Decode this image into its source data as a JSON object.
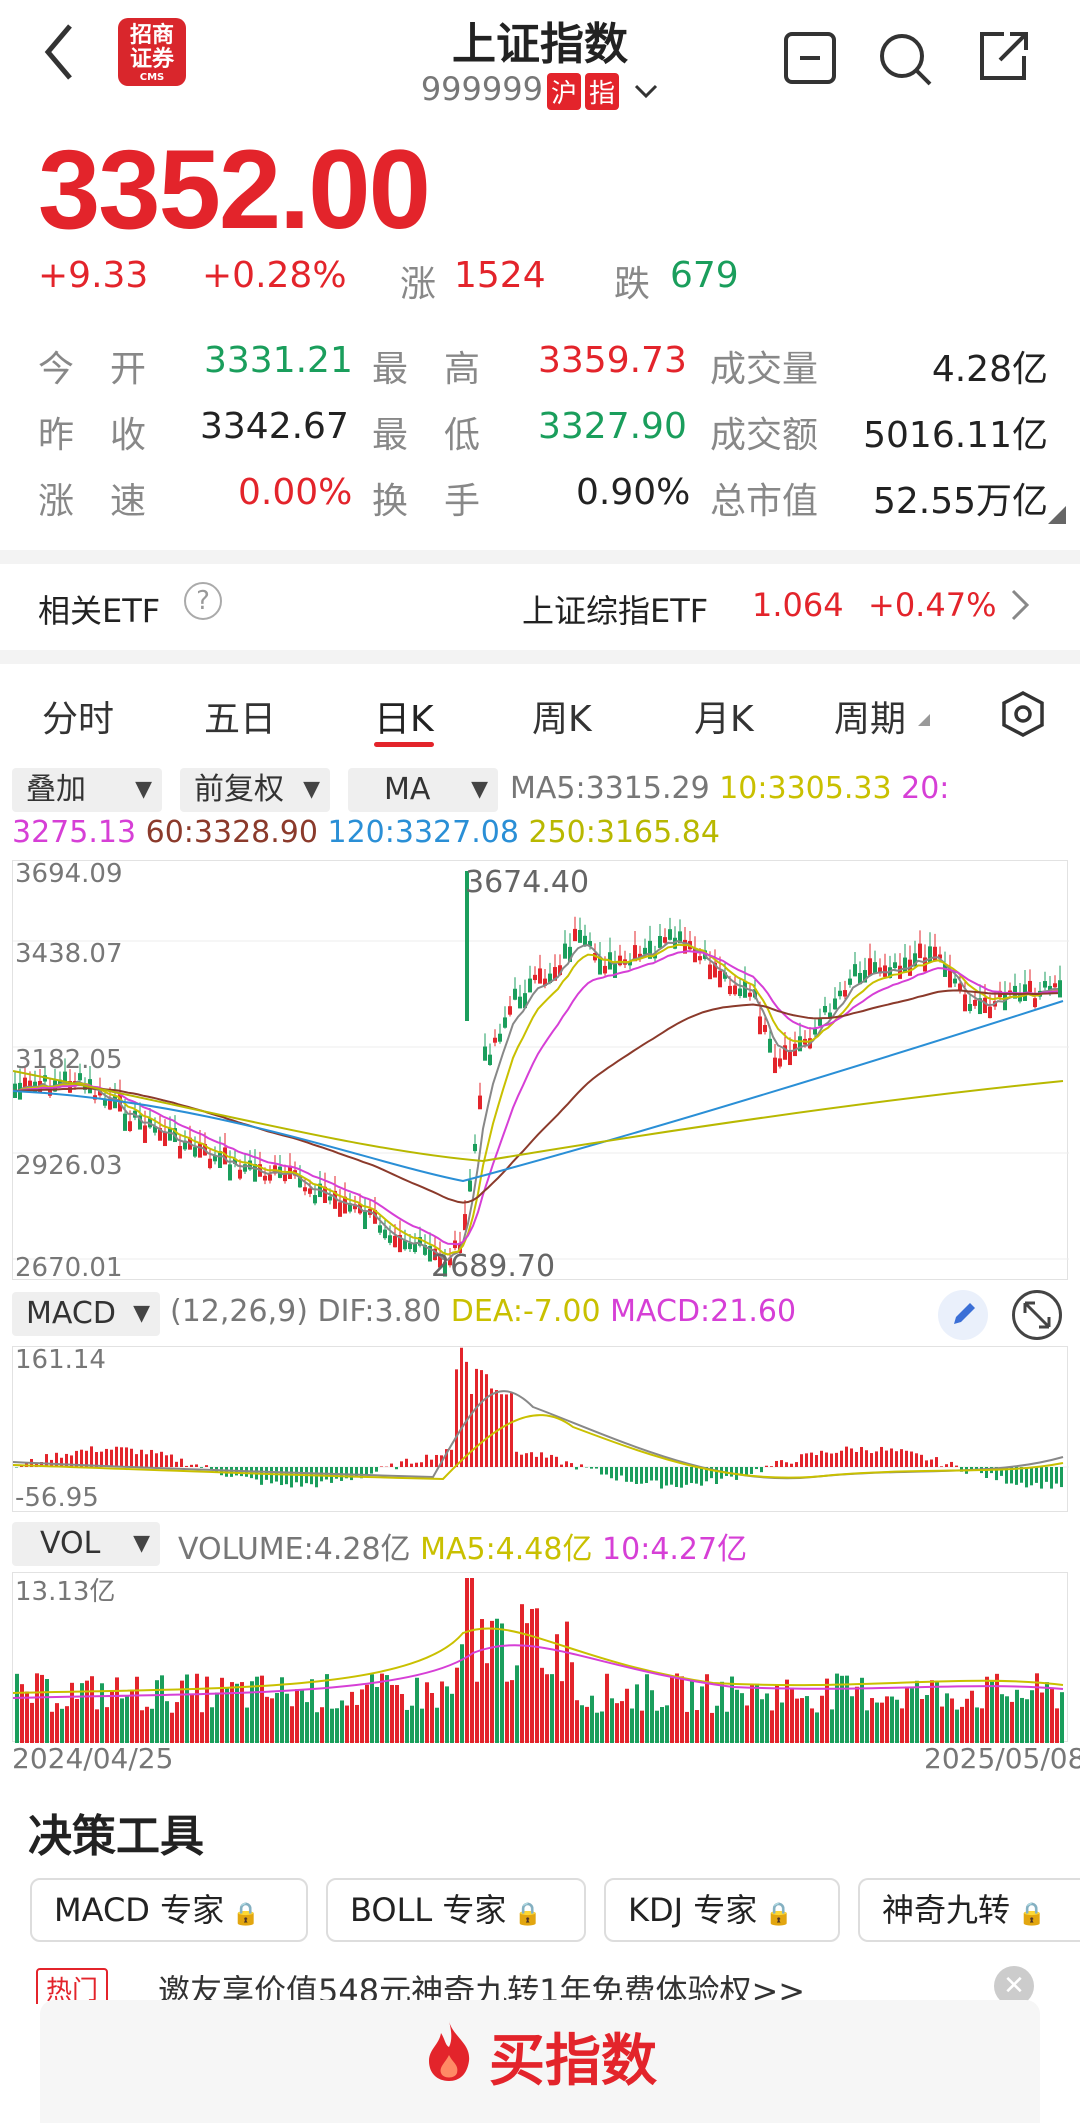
{
  "header": {
    "title": "上证指数",
    "code": "999999",
    "tag_market": "沪",
    "tag_type": "指",
    "logo_top": "招商",
    "logo_mid": "证券",
    "logo_small": "CMS"
  },
  "quote": {
    "price": "3352.00",
    "change": "+9.33",
    "change_pct": "+0.28%",
    "up_label": "涨",
    "up_count": "1524",
    "down_label": "跌",
    "down_count": "679"
  },
  "stats": {
    "open_label": "今　开",
    "open": "3331.21",
    "high_label": "最　高",
    "high": "3359.73",
    "volume_label": "成交量",
    "volume": "4.28亿",
    "prev_label": "昨　收",
    "prev": "3342.67",
    "low_label": "最　低",
    "low": "3327.90",
    "amount_label": "成交额",
    "amount": "5016.11亿",
    "speed_label": "涨　速",
    "speed": "0.00%",
    "turnover_label": "换　手",
    "turnover": "0.90%",
    "mktcap_label": "总市值",
    "mktcap": "52.55万亿"
  },
  "etf": {
    "label": "相关ETF",
    "name": "上证综指ETF",
    "price": "1.064",
    "pct": "+0.47%"
  },
  "tabs": [
    "分时",
    "五日",
    "日K",
    "周K",
    "月K",
    "周期"
  ],
  "controls": {
    "overlay": "叠加",
    "adjust": "前复权",
    "indicator": "MA"
  },
  "ma": {
    "ma5": "MA5:3315.29",
    "ma10": "10:3305.33",
    "ma20": "20:",
    "ma20_val": "3275.13",
    "ma60": "60:3328.90",
    "ma120": "120:3327.08",
    "ma250": "250:3165.84"
  },
  "kline_axis": {
    "y1": "3694.09",
    "y2": "3438.07",
    "y3": "3182.05",
    "y4": "2926.03",
    "y5": "2670.01",
    "high_mark": "3674.40",
    "low_mark": "2689.70"
  },
  "macd": {
    "name": "MACD",
    "params": "(12,26,9)",
    "dif": "DIF:3.80",
    "dea": "DEA:-7.00",
    "macd": "MACD:21.60",
    "y_top": "161.14",
    "y_bottom": "-56.95"
  },
  "vol": {
    "name": "VOL",
    "volume": "VOLUME:4.28亿",
    "ma5": "MA5:4.48亿",
    "ma10": "10:4.27亿",
    "y_top": "13.13亿",
    "date_start": "2024/04/25",
    "date_end": "2025/05/08"
  },
  "tools": {
    "title": "决策工具",
    "buttons": [
      "MACD 专家",
      "BOLL 专家",
      "KDJ 专家",
      "神奇九转"
    ]
  },
  "promo": {
    "tag": "热门",
    "text": "邀友享价值548元神奇九转1年免费体验权>>"
  },
  "buy": {
    "label": "买指数"
  },
  "colors": {
    "up": "#e3242b",
    "down": "#1a9e5c",
    "ma5": "#888888",
    "ma10": "#c9c000",
    "ma20": "#d63fd6",
    "ma60": "#8b3a2b",
    "ma120": "#2a8fd6",
    "ma250": "#b8b800"
  }
}
